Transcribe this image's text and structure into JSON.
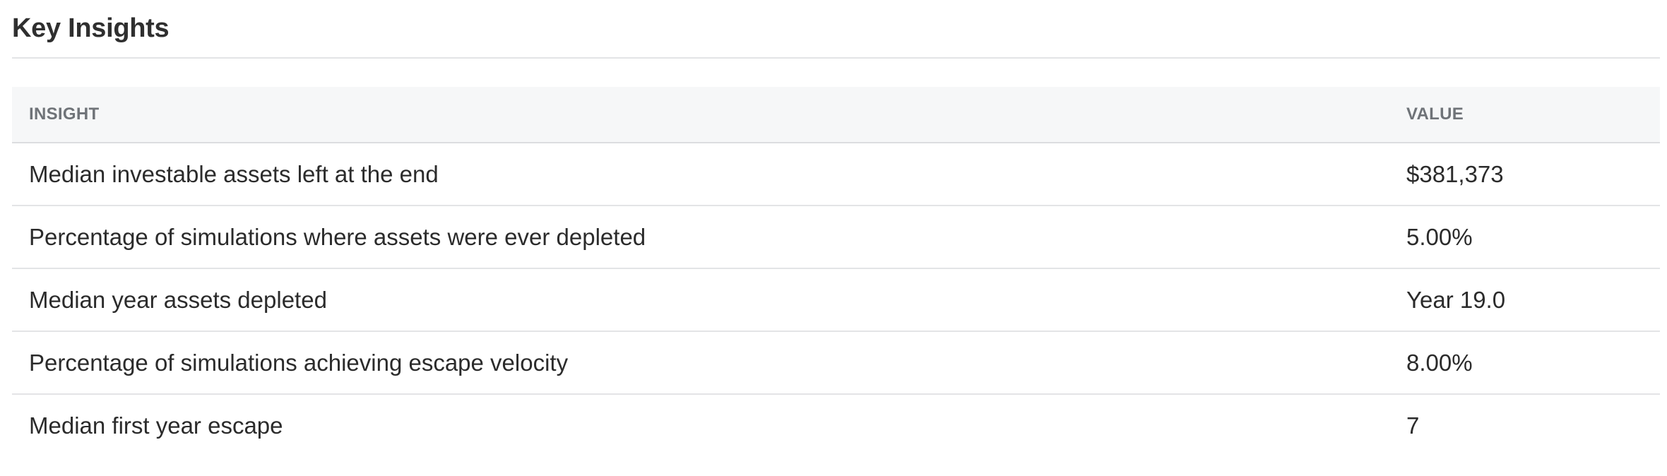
{
  "section": {
    "title": "Key Insights"
  },
  "table": {
    "headers": {
      "insight": "INSIGHT",
      "value": "VALUE"
    },
    "rows": [
      {
        "insight": "Median investable assets left at the end",
        "value": "$381,373"
      },
      {
        "insight": "Percentage of simulations where assets were ever depleted",
        "value": "5.00%"
      },
      {
        "insight": "Median year assets depleted",
        "value": "Year 19.0"
      },
      {
        "insight": "Percentage of simulations achieving escape velocity",
        "value": "8.00%"
      },
      {
        "insight": "Median first year escape",
        "value": "7"
      }
    ]
  }
}
